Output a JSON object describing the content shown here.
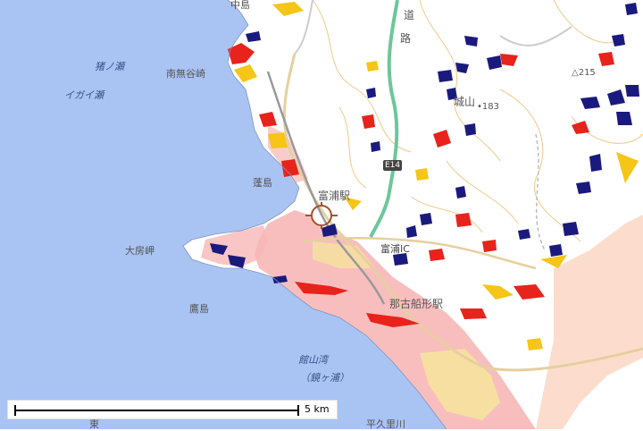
{
  "map": {
    "labels": {
      "top_cut": "中島",
      "road_name": "道",
      "road_name2": "路",
      "inoshi_se": "猪ノ瀬",
      "minami_nashi": "南無谷崎",
      "igai_se": "イガイ瀬",
      "shiroyama": "城山",
      "elev_183": "183",
      "elev_215": "215",
      "hourai_jima": "蓬島",
      "tomiura_station": "富浦駅",
      "tomiura_ic": "富浦IC",
      "ofusa_misaki": "大房岬",
      "takara_jima": "鷹島",
      "nakofunagata": "那古船形駅",
      "tateyama_wan": "館山湾",
      "kagami_ga_ura": "（鏡ヶ浦）",
      "hira_kugawa": "平久里川",
      "higashi": "東"
    },
    "route_shield": "E14",
    "scale": {
      "label": "5 km"
    },
    "colors": {
      "sea": "#a9c3f2",
      "land": "#ffffff",
      "flood_pink": "#f7b7b7",
      "flood_light": "#fcd9c8",
      "flood_yellow": "#f6e79a",
      "hazard_red": "#e8231c",
      "hazard_yellow": "#f5c518",
      "hazard_navy": "#1a1a7e",
      "highway": "#6cc79a",
      "road": "#e6cfa0",
      "contour": "#f0c98a"
    }
  }
}
